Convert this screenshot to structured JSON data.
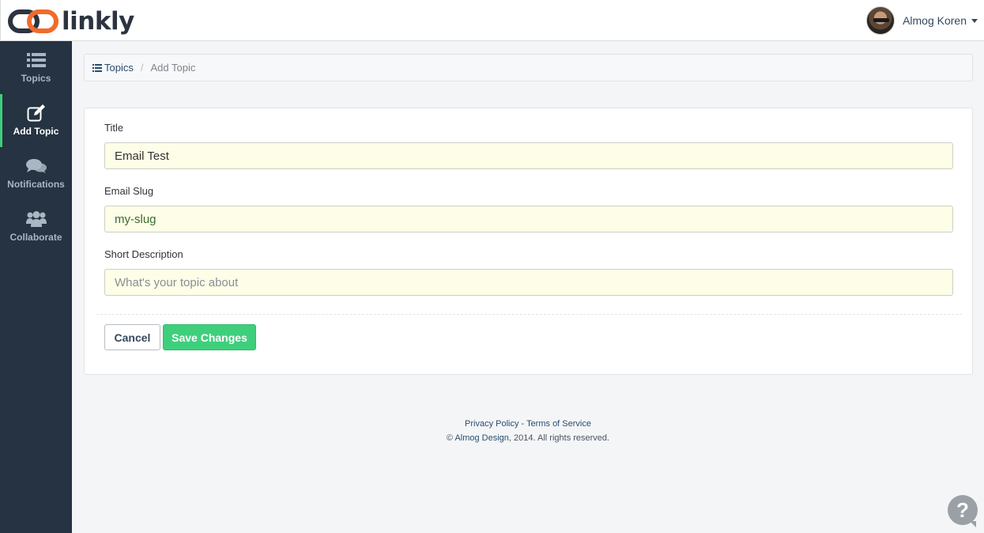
{
  "brand": {
    "name": "linkly",
    "accent": "#f26b2a",
    "dark": "#2c3440",
    "green": "#3ecf7c"
  },
  "user": {
    "name": "Almog Koren"
  },
  "sidebar": {
    "items": [
      {
        "label": "Topics",
        "icon": "list-icon",
        "active": false
      },
      {
        "label": "Add Topic",
        "icon": "edit-icon",
        "active": true
      },
      {
        "label": "Notifications",
        "icon": "comments-icon",
        "active": false
      },
      {
        "label": "Collaborate",
        "icon": "users-icon",
        "active": false
      }
    ]
  },
  "breadcrumb": {
    "parent": "Topics",
    "separator": "/",
    "current": "Add Topic"
  },
  "form": {
    "title_label": "Title",
    "title_value": "Email Test",
    "slug_label": "Email Slug",
    "slug_value": "my-slug",
    "desc_label": "Short Description",
    "desc_placeholder": "What's your topic about",
    "cancel_label": "Cancel",
    "save_label": "Save Changes"
  },
  "footer": {
    "privacy": "Privacy Policy",
    "dash": " - ",
    "terms": "Terms of Service",
    "copy_prefix": "© ",
    "company": "Almog Design",
    "copy_suffix": ", 2014. All rights reserved."
  },
  "help": {
    "label": "?"
  }
}
